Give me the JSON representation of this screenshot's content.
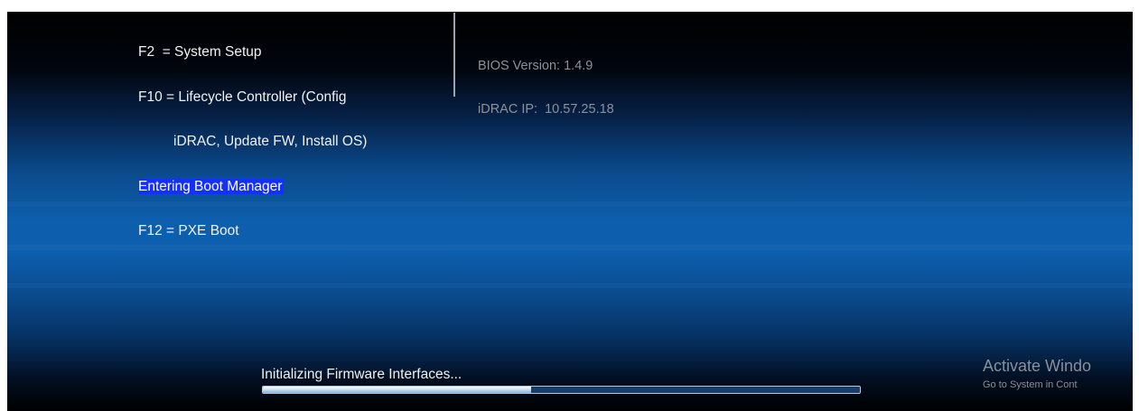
{
  "boot_menu": {
    "items": [
      {
        "label": "F2  = System Setup",
        "indent": false,
        "highlight": false
      },
      {
        "label": "F10 = Lifecycle Controller (Config",
        "indent": false,
        "highlight": false
      },
      {
        "label": "iDRAC, Update FW, Install OS)",
        "indent": true,
        "highlight": false
      },
      {
        "label": "Entering Boot Manager",
        "indent": false,
        "highlight": true
      },
      {
        "label": "F12 = PXE Boot",
        "indent": false,
        "highlight": false
      }
    ]
  },
  "system_info": {
    "bios_version": "BIOS Version: 1.4.9",
    "idrac_ip": "iDRAC IP:  10.57.25.18"
  },
  "status": {
    "message": "Initializing Firmware Interfaces...",
    "progress": 0.45
  },
  "activation_watermark": {
    "title": "Activate Windo",
    "subtitle": "Go to System in Cont"
  },
  "colors": {
    "highlight": "#1430ff",
    "text": "#f2f2f2",
    "info_text": "#8d9199",
    "background_mid": "#0d5eab"
  }
}
